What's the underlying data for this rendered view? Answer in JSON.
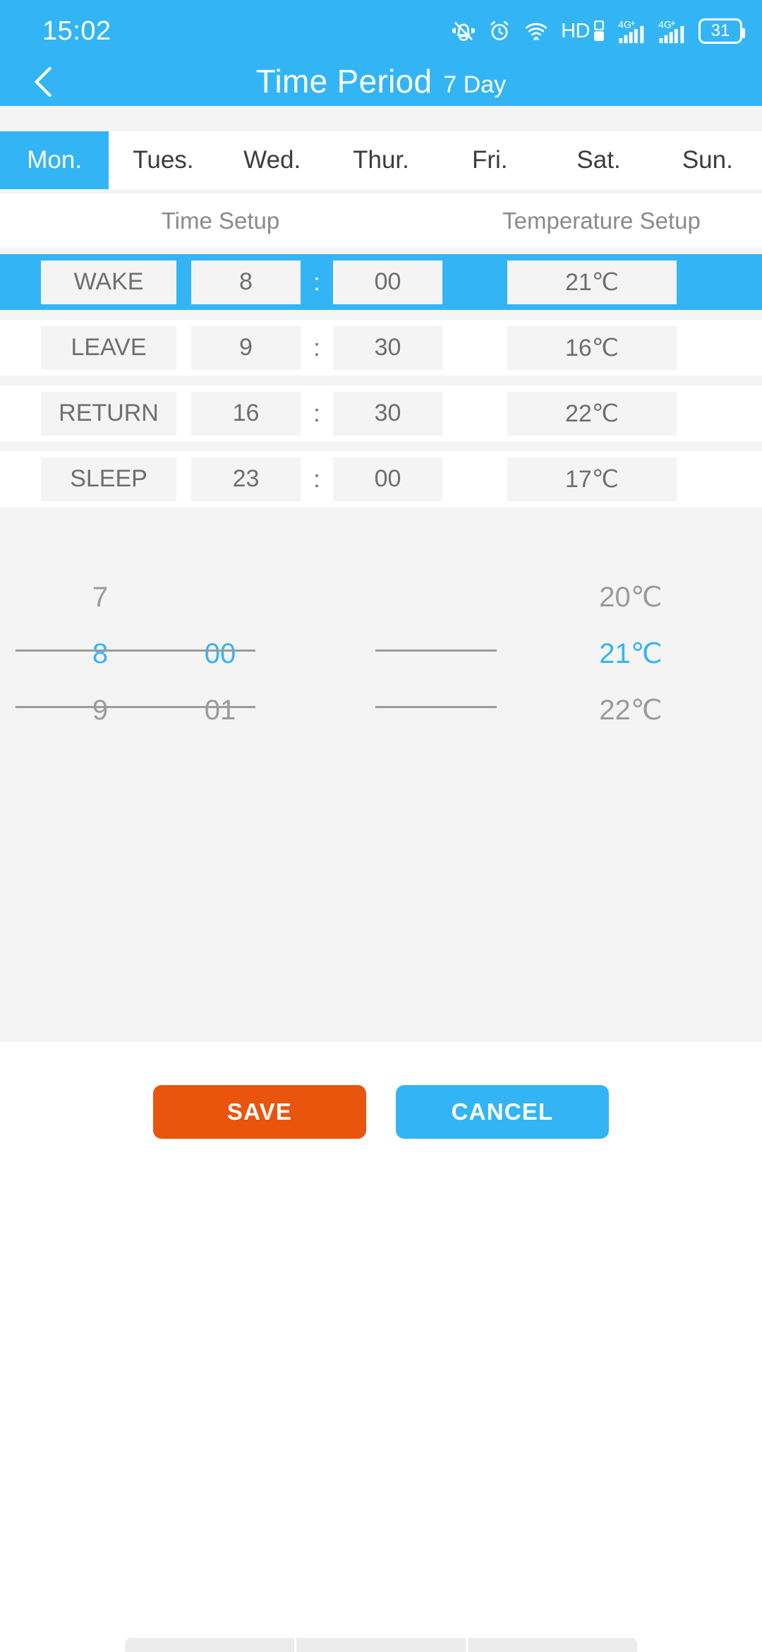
{
  "status_bar": {
    "clock": "15:02",
    "battery_level": "31",
    "hd_label": "HD",
    "network_label": "4G+",
    "icons": [
      "mute-bell-icon",
      "alarm-clock-icon",
      "wifi-icon",
      "hd-icon",
      "signal-4g-plus-icon-1",
      "signal-4g-plus-icon-2",
      "battery-icon"
    ]
  },
  "header": {
    "back_icon": "chevron-left-icon",
    "title": "Time Period",
    "subtitle": "7 Day",
    "accent_color": "#33B5F5"
  },
  "day_tabs": {
    "selected_index": 0,
    "items": [
      {
        "label": "Mon."
      },
      {
        "label": "Tues."
      },
      {
        "label": "Wed."
      },
      {
        "label": "Thur."
      },
      {
        "label": "Fri."
      },
      {
        "label": "Sat."
      },
      {
        "label": "Sun."
      }
    ]
  },
  "section_headers": {
    "time_setup": "Time Setup",
    "temperature_setup": "Temperature Setup"
  },
  "schedule": {
    "colon": ":",
    "rows": [
      {
        "label": "WAKE",
        "hour": "8",
        "minute": "00",
        "temperature": "21℃",
        "selected": true
      },
      {
        "label": "LEAVE",
        "hour": "9",
        "minute": "30",
        "temperature": "16℃",
        "selected": false
      },
      {
        "label": "RETURN",
        "hour": "16",
        "minute": "30",
        "temperature": "22℃",
        "selected": false
      },
      {
        "label": "SLEEP",
        "hour": "23",
        "minute": "00",
        "temperature": "17℃",
        "selected": false
      }
    ]
  },
  "picker": {
    "selected_color": "#33B5F5",
    "hour": {
      "prev": "7",
      "current": "8",
      "next": "9"
    },
    "minute": {
      "prev": "",
      "current": "00",
      "next": "01"
    },
    "temperature": {
      "prev": "20℃",
      "current": "21℃",
      "next": "22℃"
    }
  },
  "footer": {
    "save_label": "SAVE",
    "cancel_label": "CANCEL",
    "save_color": "#E9550D",
    "cancel_color": "#33B5F5"
  }
}
